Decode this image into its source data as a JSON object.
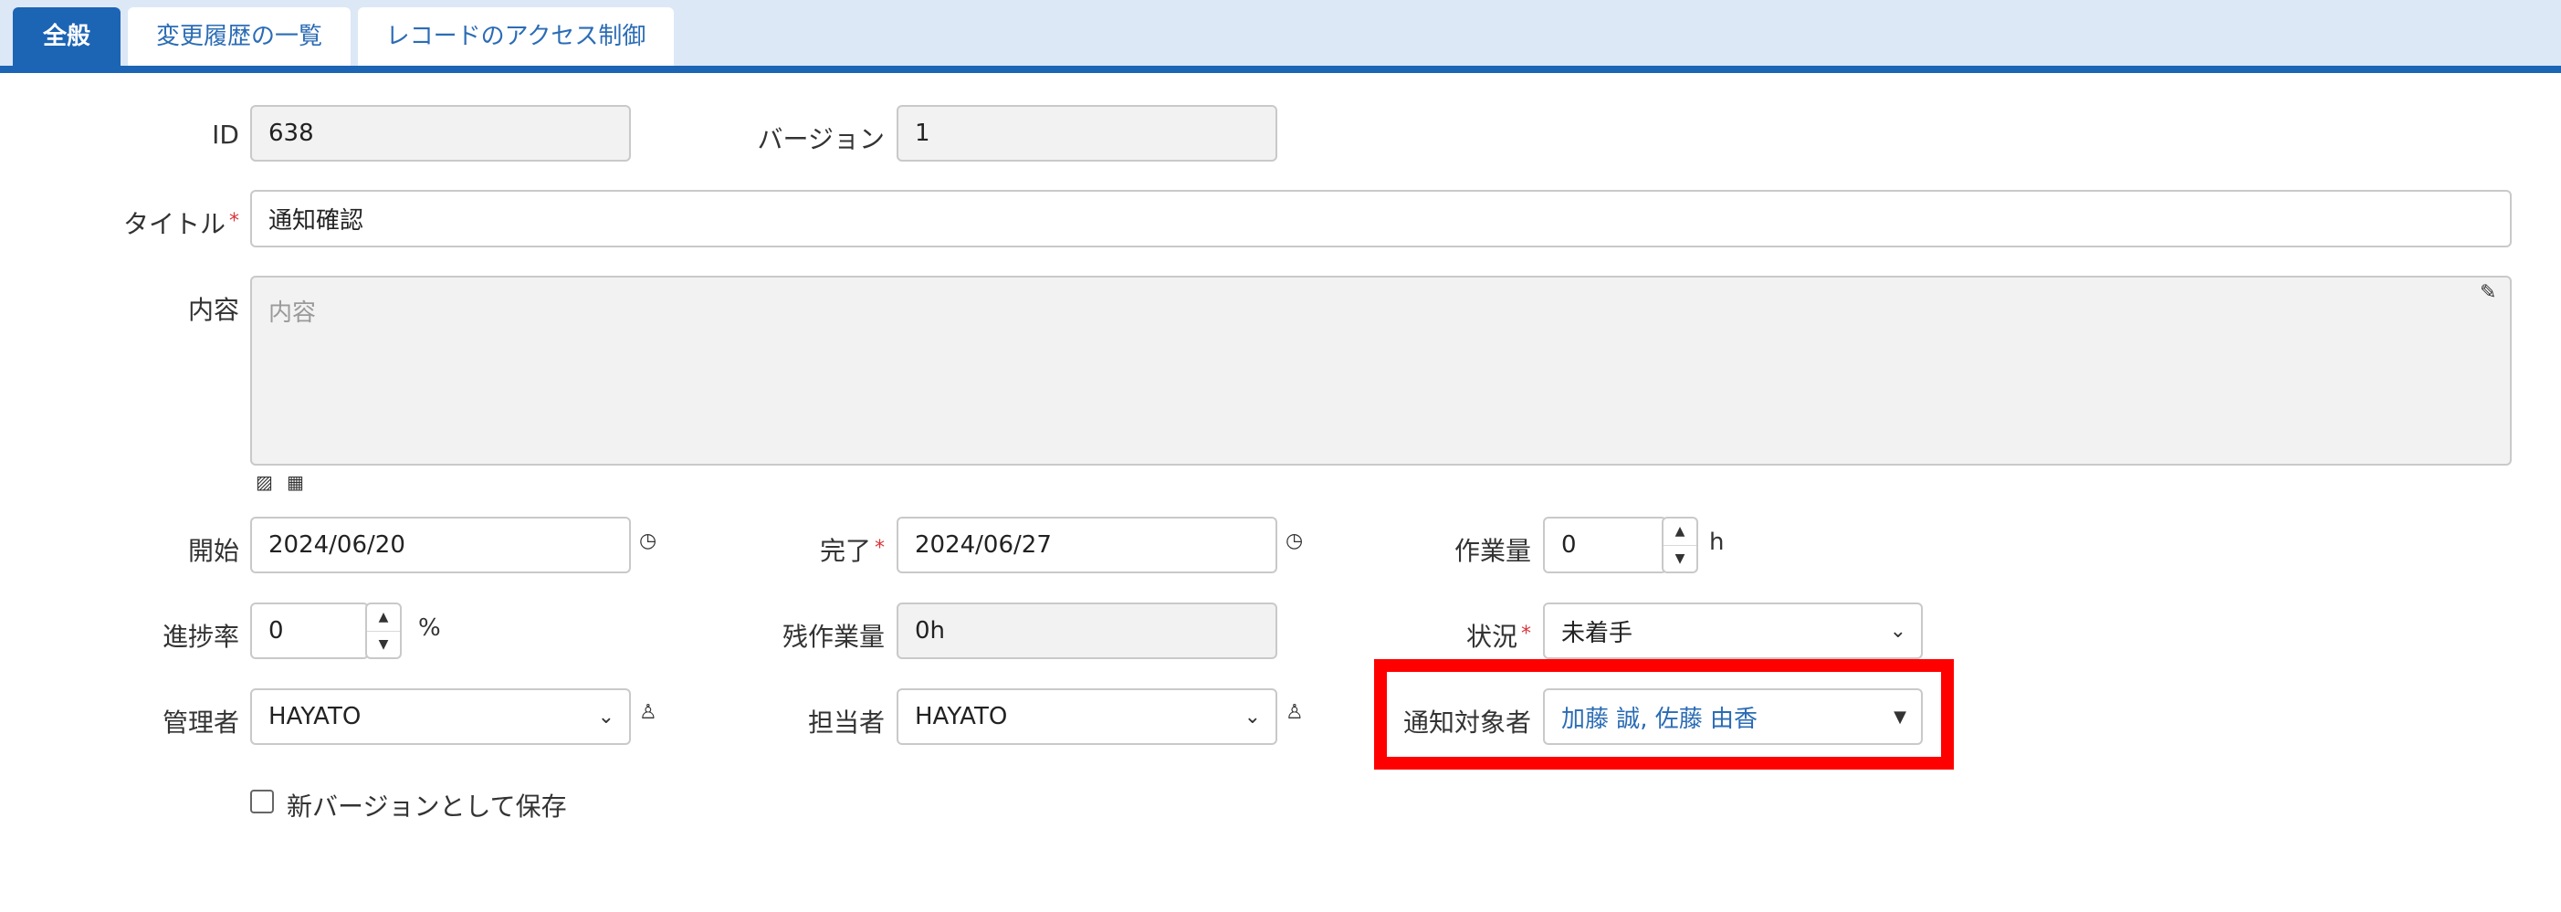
{
  "tabs": [
    {
      "label": "全般",
      "active": true
    },
    {
      "label": "変更履歴の一覧",
      "active": false
    },
    {
      "label": "レコードのアクセス制御",
      "active": false
    }
  ],
  "form": {
    "id": {
      "label": "ID",
      "value": "638"
    },
    "version": {
      "label": "バージョン",
      "value": "1"
    },
    "title": {
      "label": "タイトル",
      "required_mark": "*",
      "value": "通知確認"
    },
    "content": {
      "label": "内容",
      "placeholder": "内容"
    },
    "start": {
      "label": "開始",
      "value": "2024/06/20"
    },
    "end": {
      "label": "完了",
      "required_mark": "*",
      "value": "2024/06/27"
    },
    "workload": {
      "label": "作業量",
      "value": "0",
      "unit": "h"
    },
    "progress": {
      "label": "進捗率",
      "value": "0",
      "unit": "%"
    },
    "remaining": {
      "label": "残作業量",
      "value": "0h"
    },
    "status": {
      "label": "状況",
      "required_mark": "*",
      "value": "未着手"
    },
    "manager": {
      "label": "管理者",
      "value": "HAYATO"
    },
    "owner": {
      "label": "担当者",
      "value": "HAYATO"
    },
    "notify": {
      "label": "通知対象者",
      "value": "加藤 誠, 佐藤 由香"
    },
    "new_version": {
      "label": "新バージョンとして保存",
      "checked": false
    }
  },
  "colors": {
    "accent": "#1c64b4",
    "tab_bar": "#dce8f6",
    "highlight": "#ff0000",
    "required": "#d9343a",
    "link_text": "#2b6cb5"
  },
  "icons": [
    "clock-icon",
    "user-icon",
    "pencil-icon",
    "image-icon",
    "table-icon",
    "chevron-down-icon",
    "caret-down-icon",
    "spinner-up-icon",
    "spinner-down-icon"
  ]
}
